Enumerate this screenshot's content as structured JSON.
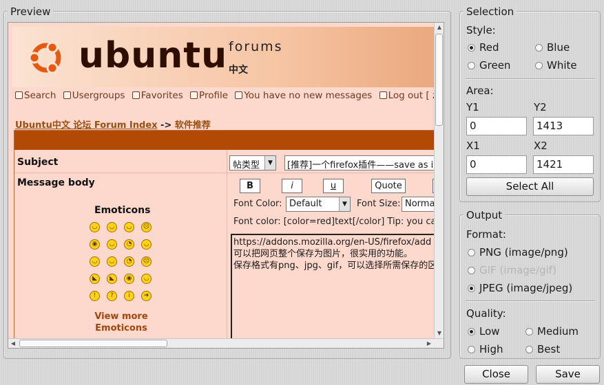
{
  "preview": {
    "legend": "Preview",
    "banner": {
      "logo_word": "ubuntu",
      "forums": "forums",
      "chinese": "中文"
    },
    "nav": [
      {
        "icon": "search-icon",
        "label": "Search"
      },
      {
        "icon": "usergroups-icon",
        "label": "Usergroups"
      },
      {
        "icon": "favorites-icon",
        "label": "Favorites"
      },
      {
        "icon": "profile-icon",
        "label": "Profile"
      },
      {
        "icon": "messages-icon",
        "label": "You have no new messages"
      },
      {
        "icon": "logout-icon",
        "label": "Log out [ zł"
      }
    ],
    "breadcrumb": {
      "link": "Ubuntu中文 论坛 Forum Index",
      "arrow": "->",
      "current": "软件推荐"
    },
    "form": {
      "subject_label": "Subject",
      "type_select": "帖类型",
      "subject_value": "[推荐]一个firefox插件——save as ima",
      "message_label": "Message body",
      "buttons": {
        "bold": "B",
        "italic": "i",
        "underline": "u",
        "quote": "Quote"
      },
      "font_color_label": "Font Color:",
      "font_color_value": "Default",
      "font_size_label": "Font Size:",
      "font_size_value": "Normal",
      "hint": "Font color: [color=red]text[/color]  Tip: you ca",
      "emoticons_title": "Emoticons",
      "emoticon_glyphs": [
        "◡",
        "◡",
        "◡",
        "☹",
        "◉",
        "◡",
        "◔",
        "◡",
        "◡",
        "◡",
        "◔",
        "☹",
        "◣",
        "◣",
        "◉",
        "◡",
        "!",
        "?",
        "i",
        "➜"
      ],
      "view_more": "View more Emoticons",
      "message_lines": [
        "https://addons.mozilla.org/en-US/firefox/add",
        "可以把网页整个保存为图片，很实用的功能。",
        "保存格式有png、jpg、gif，可以选择所需保存的区域"
      ]
    }
  },
  "selection": {
    "legend": "Selection",
    "style_label": "Style:",
    "styles": [
      {
        "label": "Red",
        "checked": true
      },
      {
        "label": "Blue",
        "checked": false
      },
      {
        "label": "Green",
        "checked": false
      },
      {
        "label": "White",
        "checked": false
      }
    ],
    "area_label": "Area:",
    "y1_label": "Y1",
    "y1_value": "0",
    "y2_label": "Y2",
    "y2_value": "1413",
    "x1_label": "X1",
    "x1_value": "0",
    "x2_label": "X2",
    "x2_value": "1421",
    "select_all": "Select All"
  },
  "output": {
    "legend": "Output",
    "format_label": "Format:",
    "formats": [
      {
        "label": "PNG (image/png)",
        "checked": false,
        "disabled": false
      },
      {
        "label": "GIF (image/gif)",
        "checked": false,
        "disabled": true
      },
      {
        "label": "JPEG (image/jpeg)",
        "checked": true,
        "disabled": false
      }
    ],
    "quality_label": "Quality:",
    "qualities": [
      {
        "label": "Low",
        "checked": true
      },
      {
        "label": "Medium",
        "checked": false
      },
      {
        "label": "High",
        "checked": false
      },
      {
        "label": "Best",
        "checked": false
      }
    ]
  },
  "actions": {
    "close": "Close",
    "save": "Save"
  },
  "colors": {
    "banner_accent": "#b24a06",
    "link": "#9a4f10",
    "page_bg": "#fdd8cc"
  }
}
